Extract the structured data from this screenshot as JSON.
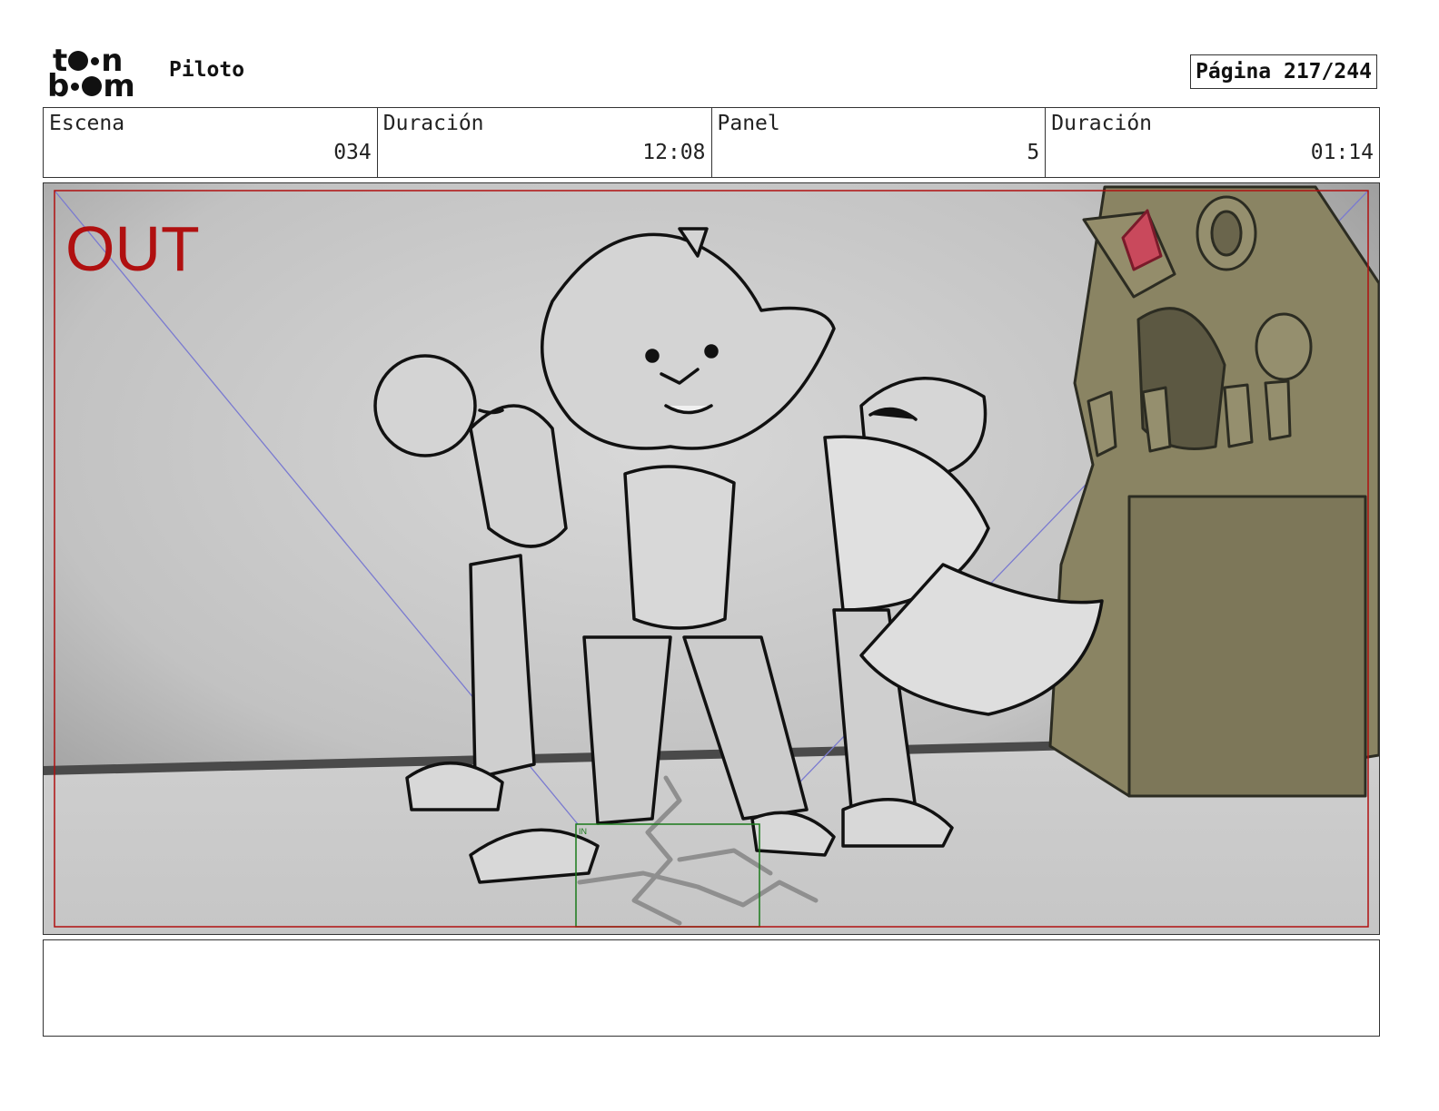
{
  "header": {
    "logo": {
      "top_letters": [
        "t",
        "n"
      ],
      "bottom_letters": [
        "b",
        "m"
      ]
    },
    "project_title": "Piloto",
    "page_label": "Página 217/244"
  },
  "info": {
    "scene_label": "Escena",
    "scene_value": "034",
    "scene_duration_label": "Duración",
    "scene_duration_value": "12:08",
    "panel_label": "Panel",
    "panel_value": "5",
    "panel_duration_label": "Duración",
    "panel_duration_value": "01:14"
  },
  "frame": {
    "out_label": "OUT",
    "in_label": "IN"
  },
  "colors": {
    "out_red": "#b01010",
    "in_green": "#1a7a1a",
    "guide_blue": "#7a7ad0",
    "statue": "#8a8463"
  },
  "notes": ""
}
